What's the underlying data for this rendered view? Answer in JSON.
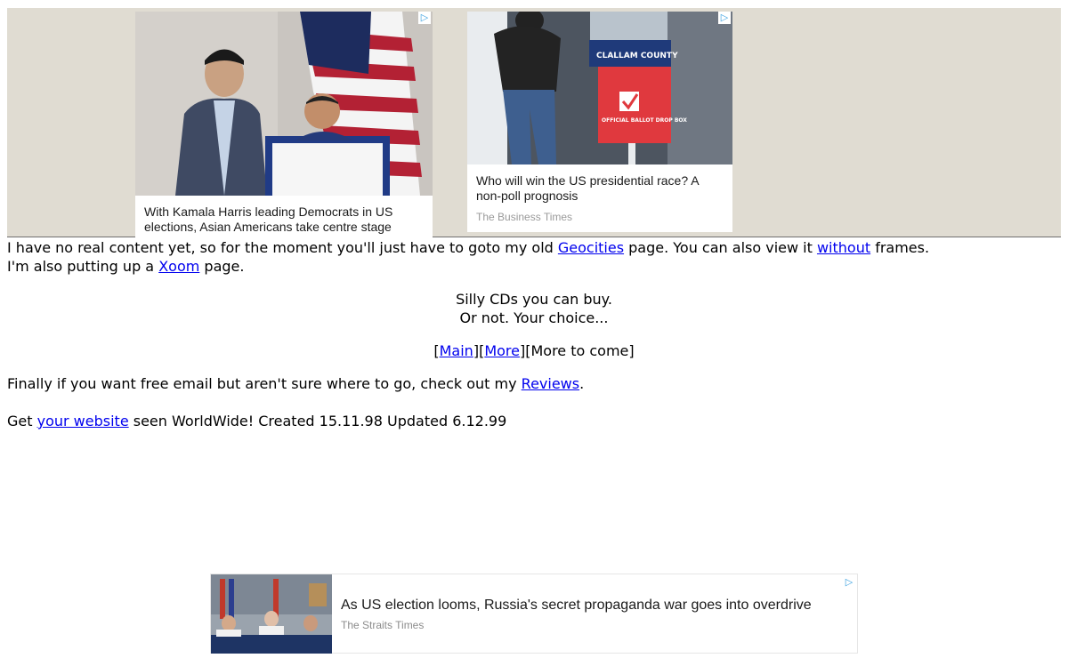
{
  "ads": {
    "top_left": {
      "headline": "With Kamala Harris leading Democrats in US elections, Asian Americans take centre stage"
    },
    "top_right": {
      "headline": "Who will win the US presidential race? A non-poll prognosis",
      "source": "The Business Times",
      "image_sign_title": "CLALLAM COUNTY",
      "image_sign_text": "OFFICIAL BALLOT DROP BOX"
    },
    "bottom": {
      "headline": "As US election looms, Russia's secret propaganda war goes into overdrive",
      "source": "The Straits Times"
    },
    "choices_icon": "ad-choices-icon"
  },
  "content": {
    "intro": {
      "part1": "I have no real content yet, so for the moment you'll just have to goto my old ",
      "link_geocities": "Geocities",
      "part2": " page. You can also view it ",
      "link_without": "without",
      "part3": " frames."
    },
    "xoom": {
      "part1": "I'm also putting up a ",
      "link_xoom": "Xoom",
      "part2": " page."
    },
    "cds": {
      "line1": "Silly CDs you can buy.",
      "line2": "Or not. Your choice..."
    },
    "nav": {
      "open1": "[",
      "main": "Main",
      "mid": "][",
      "more": "More",
      "close": "][More to come]"
    },
    "email": {
      "part1": "Finally if you want free email but aren't sure where to go, check out my ",
      "link_reviews": "Reviews",
      "part2": "."
    },
    "footer": {
      "part1": "Get ",
      "link_website": "your website",
      "part2": " seen WorldWide! Created 15.11.98 Updated 6.12.99"
    }
  },
  "colors": {
    "link": "#0000ee",
    "ad_band_bg": "#e0dcd2",
    "ad_choices": "#3aa0e0"
  }
}
